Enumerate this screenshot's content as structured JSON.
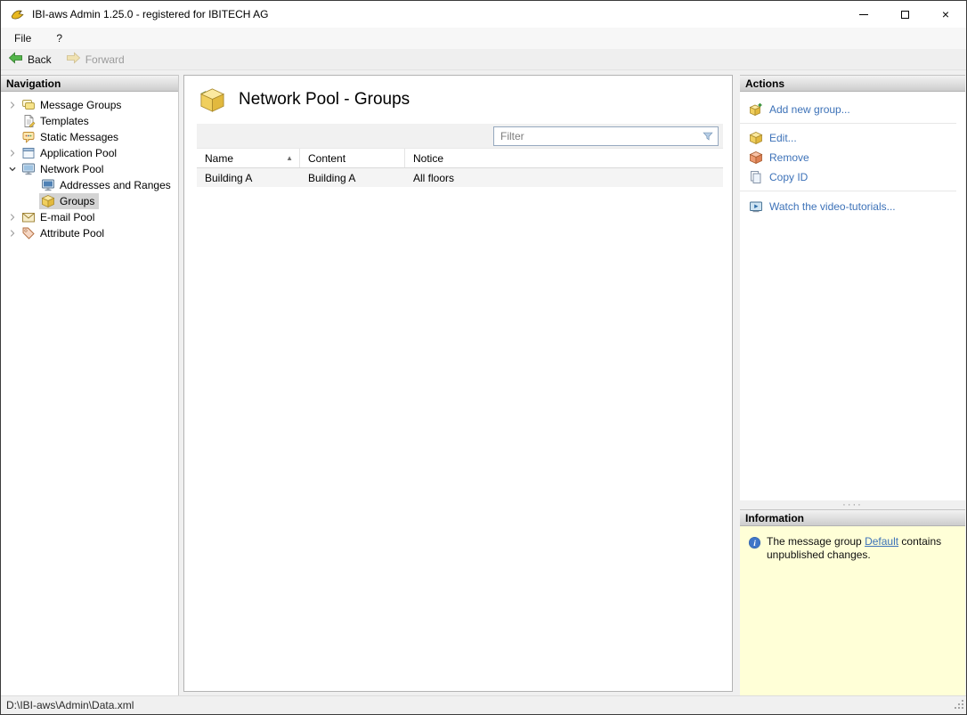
{
  "window": {
    "title": "IBI-aws Admin 1.25.0 - registered for IBITECH AG"
  },
  "icons": {
    "close": "×",
    "sort_asc": "▲",
    "splitter_dots": "····"
  },
  "menu": {
    "items": [
      {
        "label": "File"
      },
      {
        "label": "?"
      }
    ]
  },
  "toolbar": {
    "back_label": "Back",
    "forward_label": "Forward"
  },
  "navigation": {
    "header": "Navigation",
    "items": [
      {
        "label": "Message Groups",
        "state": "collapsed"
      },
      {
        "label": "Templates"
      },
      {
        "label": "Static Messages"
      },
      {
        "label": "Application Pool",
        "state": "collapsed"
      },
      {
        "label": "Network Pool",
        "state": "expanded"
      },
      {
        "label": "Addresses and Ranges",
        "child": true
      },
      {
        "label": "Groups",
        "child": true,
        "selected": true
      },
      {
        "label": "E-mail Pool",
        "state": "collapsed"
      },
      {
        "label": "Attribute Pool",
        "state": "collapsed"
      }
    ]
  },
  "main": {
    "title": "Network Pool - Groups",
    "filter_placeholder": "Filter",
    "table": {
      "columns": [
        "Name",
        "Content",
        "Notice"
      ],
      "sort": {
        "column": "Name",
        "direction": "asc"
      },
      "rows": [
        {
          "name": "Building A",
          "content": "Building A",
          "notice": "All floors"
        }
      ]
    }
  },
  "actions": {
    "header": "Actions",
    "items": [
      {
        "label": "Add new group..."
      },
      {
        "label": "Edit..."
      },
      {
        "label": "Remove"
      },
      {
        "label": "Copy ID"
      },
      {
        "label": "Watch the video-tutorials..."
      }
    ]
  },
  "information": {
    "header": "Information",
    "message_before": "The message group ",
    "link_label": "Default",
    "message_after": " contains unpublished changes."
  },
  "statusbar": {
    "path": "D:\\IBI-aws\\Admin\\Data.xml"
  }
}
